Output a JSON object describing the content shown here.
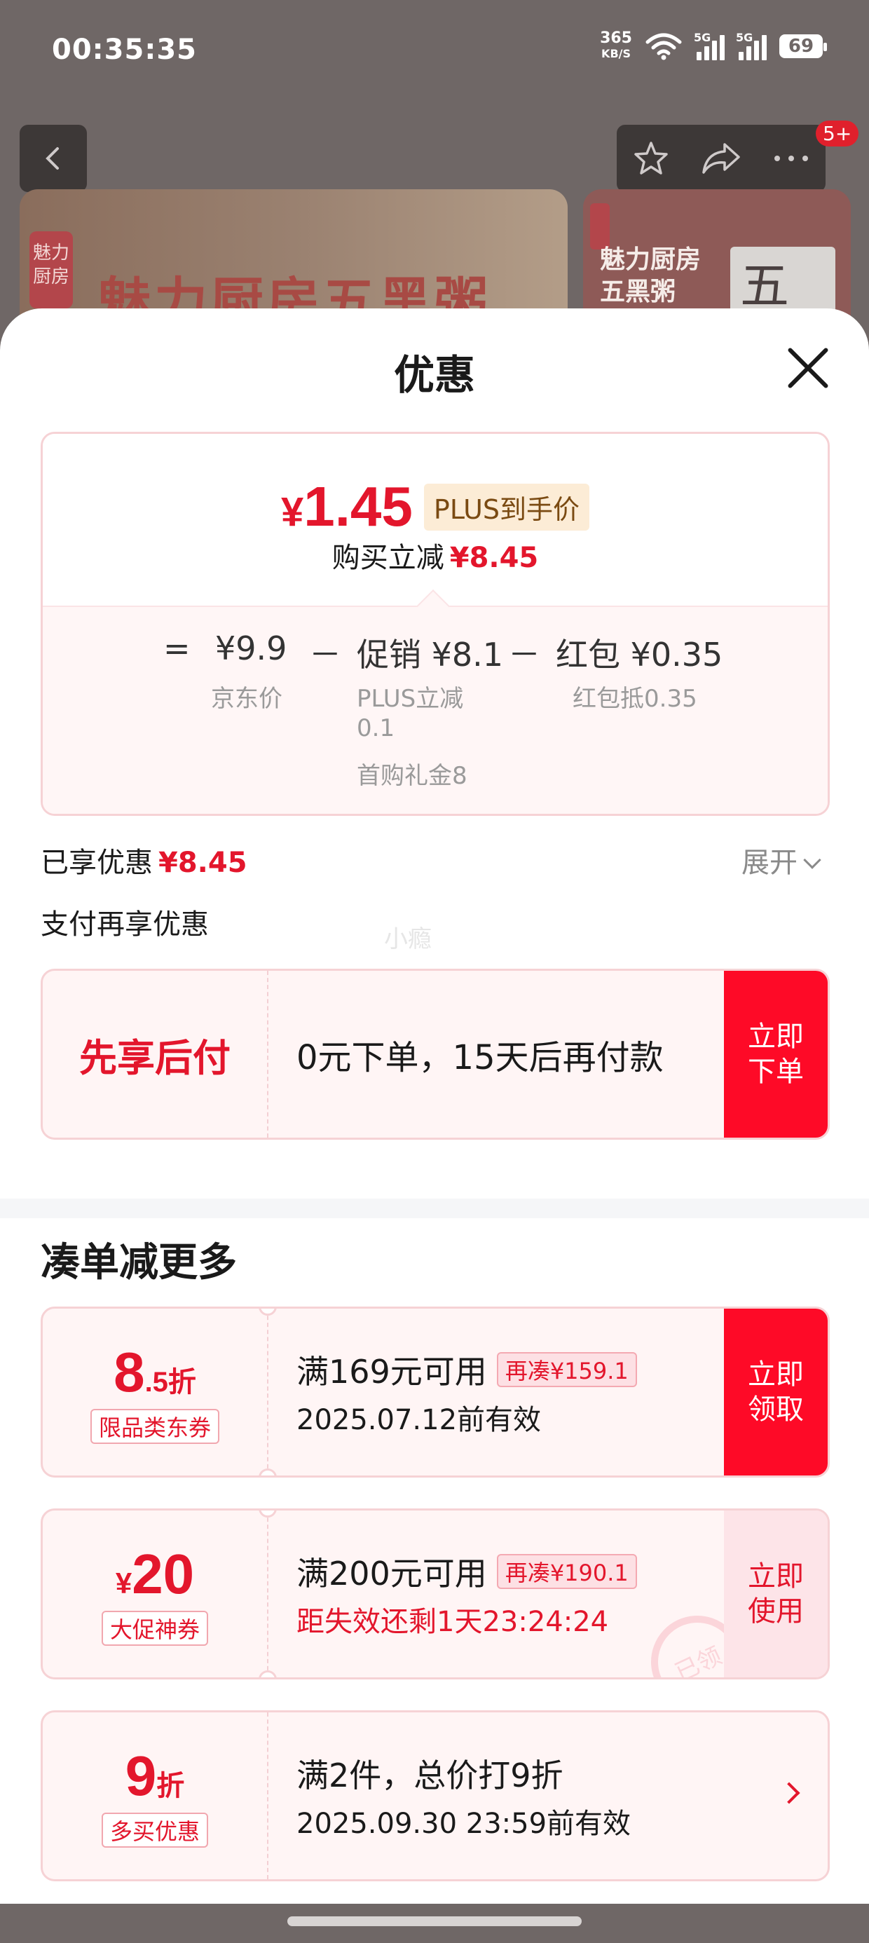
{
  "status_bar": {
    "time": "00:35:35",
    "net_speed": "365",
    "net_unit": "KB/S",
    "network1": "5G",
    "network2": "5G",
    "battery": "69"
  },
  "product_page": {
    "notification_badge": "5+",
    "banner_logo": "魅力厨房",
    "banner_title": "魅力厨房五黑粥",
    "banner_right_text_line1": "魅力厨房",
    "banner_right_text_line2": "五黑粥",
    "banner_right_box": "五"
  },
  "sheet": {
    "title": "优惠",
    "price_card": {
      "final_price_symbol": "¥",
      "final_price": "1.45",
      "plus_tag": "PLUS到手价",
      "buy_reduce_label": "购买立减",
      "buy_reduce_value": "¥8.45",
      "equals": "=",
      "jd_price": "¥9.9",
      "jd_price_label": "京东价",
      "minus1": "－",
      "promo": "促销 ¥8.1",
      "promo_detail1": "PLUS立减",
      "promo_detail1b": "0.1",
      "promo_detail2": "首购礼金8",
      "minus2": "－",
      "redpacket": "红包 ¥0.35",
      "redpacket_detail": "红包抵0.35"
    },
    "enjoyed_label": "已享优惠",
    "enjoyed_value": "¥8.45",
    "expand_label": "展开",
    "pay_more_label": "支付再享优惠",
    "watermark": "小瘾",
    "bnpl": {
      "title": "先享后付",
      "desc": "0元下单，15天后再付款",
      "button_line1": "立即",
      "button_line2": "下单"
    },
    "more_section_title": "凑单减更多",
    "coupons": [
      {
        "big": "8",
        "small": ".5折",
        "tag": "限品类东券",
        "condition": "满169元可用",
        "chip": "再凑¥159.1",
        "expiry": "2025.07.12前有效",
        "button_line1": "立即",
        "button_line2": "领取"
      },
      {
        "prefix": "¥",
        "big": "20",
        "tag": "大促神券",
        "condition": "满200元可用",
        "chip": "再凑¥190.1",
        "expiry": "距失效还剩1天23:24:24",
        "stamp": "已领",
        "button_line1": "立即",
        "button_line2": "使用"
      },
      {
        "big": "9",
        "small": "折",
        "tag": "多买优惠",
        "condition": "满2件，总价打9折",
        "expiry": "2025.09.30 23:59前有效"
      }
    ]
  },
  "colors": {
    "accent_red": "#e3162c",
    "button_red": "#fe0a27",
    "card_bg": "#fff5f5",
    "plus_tag_bg": "#fcecd6"
  }
}
